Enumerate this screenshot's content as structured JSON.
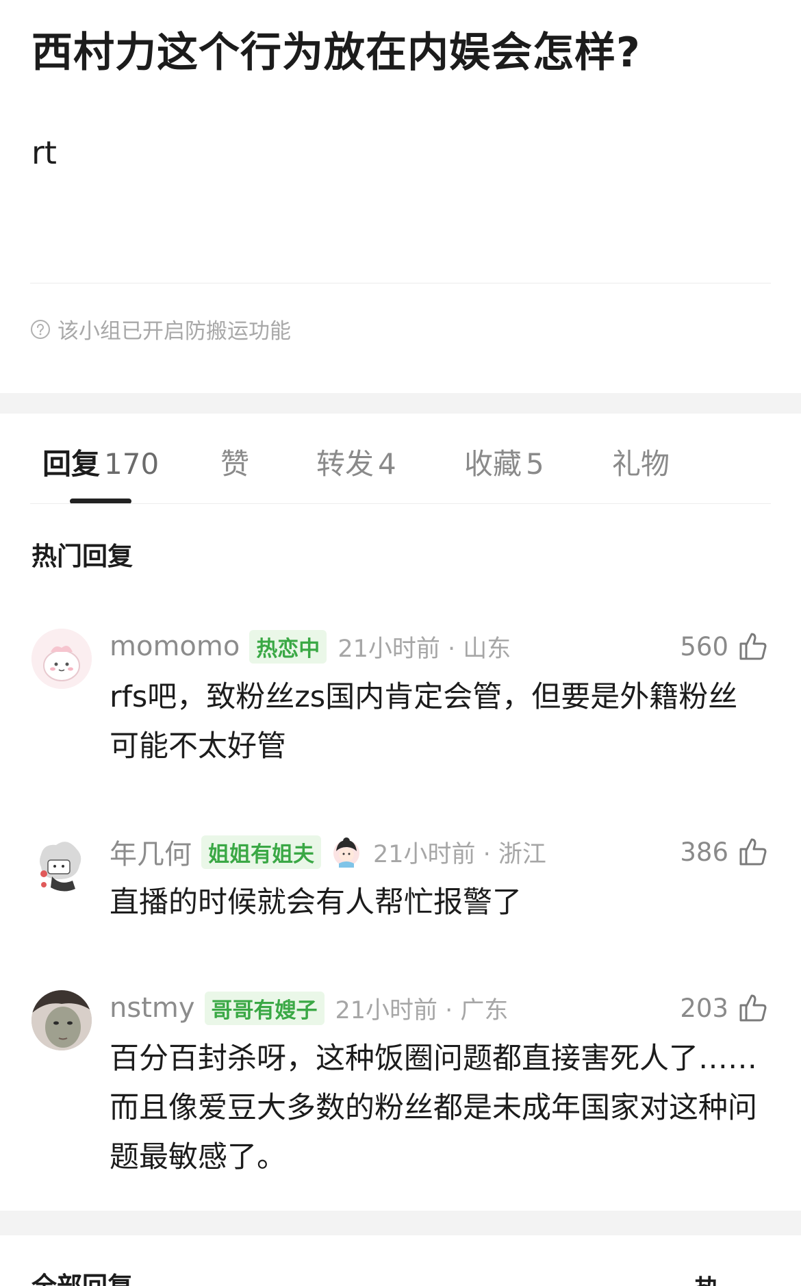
{
  "post": {
    "title": "西村力这个行为放在内娱会怎样?",
    "body": "rt",
    "notice": "该小组已开启防搬运功能",
    "notice_icon": "question-circle-icon"
  },
  "tabs": [
    {
      "label": "回复",
      "count": "170",
      "active": true
    },
    {
      "label": "赞",
      "count": "",
      "active": false
    },
    {
      "label": "转发",
      "count": "4",
      "active": false
    },
    {
      "label": "收藏",
      "count": "5",
      "active": false
    },
    {
      "label": "礼物",
      "count": "",
      "active": false
    }
  ],
  "hot_section": {
    "title": "热门回复"
  },
  "comments": [
    {
      "username": "momomo",
      "badge": "热恋中",
      "time": "21小时前 · 山东",
      "likes": "560",
      "text": "rfs吧，致粉丝zs国内肯定会管，但要是外籍粉丝可能不太好管"
    },
    {
      "username": "年几何",
      "badge": "姐姐有姐夫",
      "time": "21小时前 · 浙江",
      "likes": "386",
      "text": "直播的时候就会有人帮忙报警了"
    },
    {
      "username": "nstmy",
      "badge": "哥哥有嫂子",
      "time": "21小时前 · 广东",
      "likes": "203",
      "text": "百分百封杀呀，这种饭圈问题都直接害死人了……而且像爱豆大多数的粉丝都是未成年国家对这种问题最敏感了。"
    }
  ],
  "all_section": {
    "title": "全部回复",
    "sort_label": "热"
  },
  "colors": {
    "badge_bg": "#eaf7e8",
    "badge_text": "#3aa845",
    "muted_text": "#a6a6a6",
    "divider": "#f3f3f3"
  }
}
